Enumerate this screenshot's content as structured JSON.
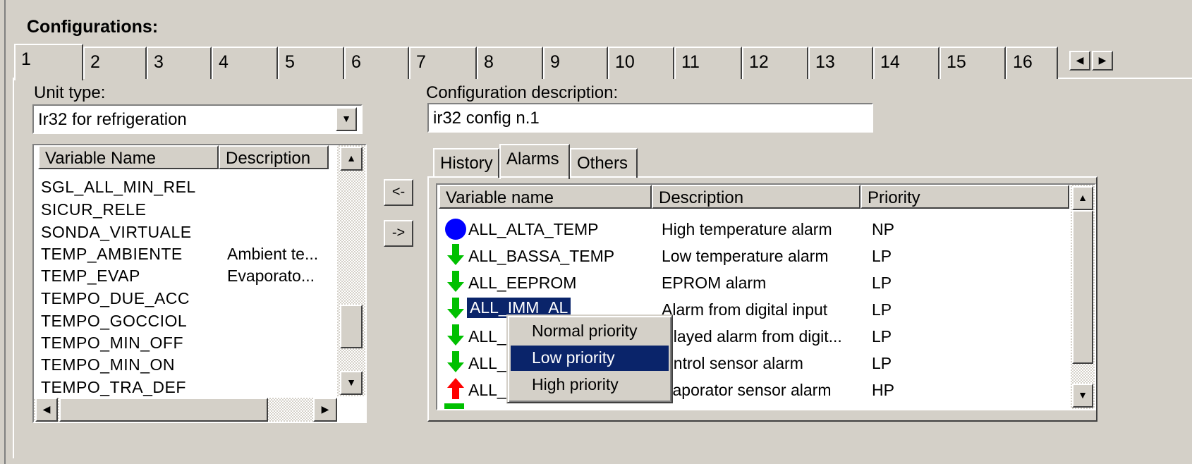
{
  "title": "Configurations:",
  "tabs": [
    "1",
    "2",
    "3",
    "4",
    "5",
    "6",
    "7",
    "8",
    "9",
    "10",
    "11",
    "12",
    "13",
    "14",
    "15",
    "16"
  ],
  "unit_type": {
    "label": "Unit type:",
    "value": "Ir32 for refrigeration"
  },
  "variables": {
    "headers": {
      "name": "Variable Name",
      "description": "Description"
    },
    "rows": [
      {
        "name": "SGL_ALL_MIN_REL",
        "description": ""
      },
      {
        "name": "SICUR_RELE",
        "description": ""
      },
      {
        "name": "SONDA_VIRTUALE",
        "description": ""
      },
      {
        "name": "TEMP_AMBIENTE",
        "description": "Ambient te..."
      },
      {
        "name": "TEMP_EVAP",
        "description": "Evaporato..."
      },
      {
        "name": "TEMPO_DUE_ACC",
        "description": ""
      },
      {
        "name": "TEMPO_GOCCIOL",
        "description": ""
      },
      {
        "name": "TEMPO_MIN_OFF",
        "description": ""
      },
      {
        "name": "TEMPO_MIN_ON",
        "description": ""
      },
      {
        "name": "TEMPO_TRA_DEF",
        "description": ""
      }
    ]
  },
  "transfer": {
    "add_label": "<-",
    "remove_label": "->"
  },
  "config_description": {
    "label": "Configuration description:",
    "value": "ir32 config n.1"
  },
  "subtabs": [
    "History",
    "Alarms",
    "Others"
  ],
  "alarms": {
    "headers": {
      "name": "Variable name",
      "description": "Description",
      "priority": "Priority"
    },
    "rows": [
      {
        "icon": "blue-circle-icon",
        "name": "ALL_ALTA_TEMP",
        "description": "High temperature alarm",
        "priority": "NP"
      },
      {
        "icon": "green-down-arrow-icon",
        "name": "ALL_BASSA_TEMP",
        "description": "Low temperature alarm",
        "priority": "LP"
      },
      {
        "icon": "green-down-arrow-icon",
        "name": "ALL_EEPROM",
        "description": "EPROM alarm",
        "priority": "LP"
      },
      {
        "icon": "green-down-arrow-icon",
        "name": "ALL_IMM_AL",
        "description": "Alarm from digital input",
        "priority": "LP"
      },
      {
        "icon": "green-down-arrow-icon",
        "name": "ALL_",
        "description": "elayed alarm from digit...",
        "priority": "LP"
      },
      {
        "icon": "green-down-arrow-icon",
        "name": "ALL_",
        "description": "ontrol sensor alarm",
        "priority": "LP"
      },
      {
        "icon": "red-up-arrow-icon",
        "name": "ALL_",
        "description": "vaporator sensor alarm",
        "priority": "HP"
      }
    ]
  },
  "context_menu": {
    "items": [
      "Normal priority",
      "Low priority",
      "High priority"
    ],
    "selected": "Low priority"
  },
  "colors": {
    "selection": "#0a246a",
    "blue_icon": "#0000ff",
    "green_icon": "#00c000",
    "red_icon": "#ff0000"
  }
}
